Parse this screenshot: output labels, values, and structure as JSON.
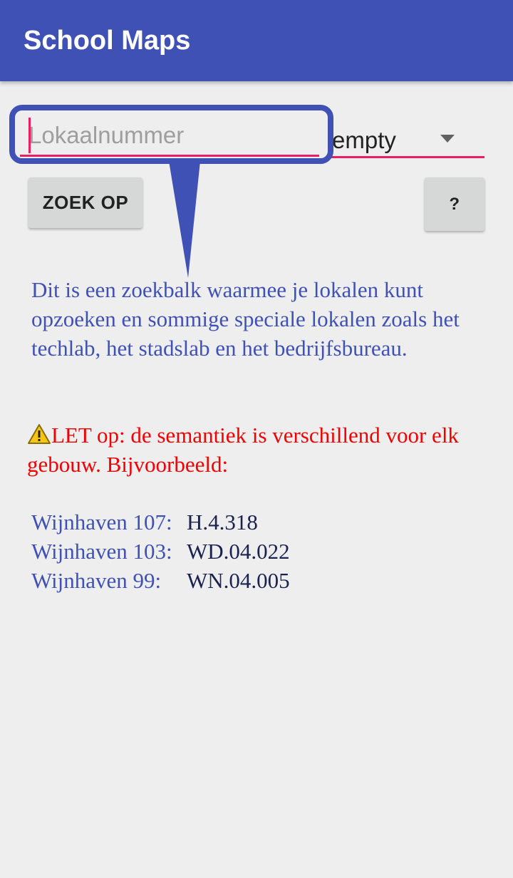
{
  "app": {
    "title": "School Maps"
  },
  "search": {
    "placeholder": "Lokaalnummer",
    "value": ""
  },
  "spinner": {
    "selected": "empty"
  },
  "buttons": {
    "search_label": "ZOEK OP",
    "help_label": "?"
  },
  "info": {
    "text": "Dit is een zoekbalk waarmee je lokalen kunt opzoeken en sommige speciale lokalen zoals het techlab, het stadslab en het bedrijfsbureau."
  },
  "warning": {
    "text": "LET op: de semantiek is verschillend voor elk gebouw.  Bijvoorbeeld:"
  },
  "examples": [
    {
      "label": "Wijnhaven 107:",
      "code": "H.4.318"
    },
    {
      "label": "Wijnhaven 103:",
      "code": "WD.04.022"
    },
    {
      "label": "Wijnhaven 99:",
      "code": "WN.04.005"
    }
  ],
  "colors": {
    "primary": "#3f51b5",
    "accent": "#e91e63",
    "warning_text": "#f00000",
    "background": "#eeeeee"
  },
  "icons": {
    "warning": "warning-triangle-icon",
    "dropdown": "dropdown-arrow-icon"
  }
}
